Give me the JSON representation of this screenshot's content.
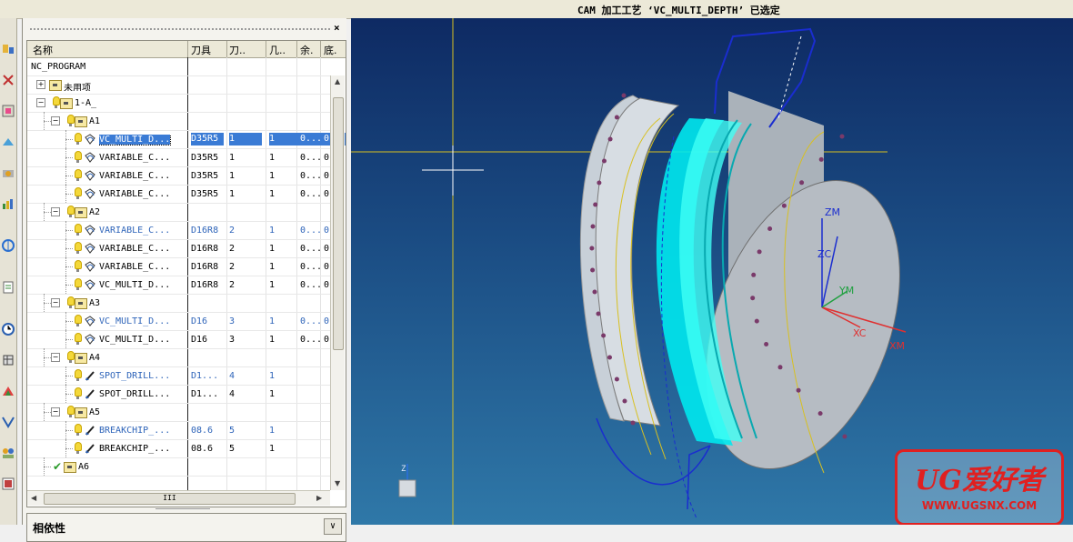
{
  "status_bar": {
    "text": "CAM 加工工艺 ‘VC_MULTI_DEPTH’ 已选定"
  },
  "navigator": {
    "close_label": "×",
    "columns": [
      "名称",
      "刀具",
      "刀..",
      "几..",
      "余.",
      "底."
    ],
    "rows": [
      {
        "name": "NC_PROGRAM",
        "tool": "",
        "c3": "",
        "c4": "",
        "c5": "",
        "c6": "",
        "level": 0,
        "type": "root"
      },
      {
        "name": "未用项",
        "tool": "",
        "c3": "",
        "c4": "",
        "c5": "",
        "c6": "",
        "level": 1,
        "type": "group",
        "expander": "+"
      },
      {
        "name": "1-A_",
        "tool": "",
        "c3": "",
        "c4": "",
        "c5": "",
        "c6": "",
        "level": 1,
        "type": "program",
        "expander": "−"
      },
      {
        "name": "A1",
        "tool": "",
        "c3": "",
        "c4": "",
        "c5": "",
        "c6": "",
        "level": 2,
        "type": "program",
        "expander": "−"
      },
      {
        "name": "VC_MULTI_D...",
        "tool": "D35R5",
        "c3": "1",
        "c4": "1",
        "c5": "0...",
        "c6": "0",
        "level": 3,
        "type": "op",
        "selected": true
      },
      {
        "name": "VARIABLE_C...",
        "tool": "D35R5",
        "c3": "1",
        "c4": "1",
        "c5": "0...",
        "c6": "0",
        "level": 3,
        "type": "op"
      },
      {
        "name": "VARIABLE_C...",
        "tool": "D35R5",
        "c3": "1",
        "c4": "1",
        "c5": "0...",
        "c6": "0",
        "level": 3,
        "type": "op"
      },
      {
        "name": "VARIABLE_C...",
        "tool": "D35R5",
        "c3": "1",
        "c4": "1",
        "c5": "0...",
        "c6": "0",
        "level": 3,
        "type": "op"
      },
      {
        "name": "A2",
        "tool": "",
        "c3": "",
        "c4": "",
        "c5": "",
        "c6": "",
        "level": 2,
        "type": "program",
        "expander": "−"
      },
      {
        "name": "VARIABLE_C...",
        "tool": "D16R8",
        "c3": "2",
        "c4": "1",
        "c5": "0...",
        "c6": "0",
        "level": 3,
        "type": "op",
        "blue": true
      },
      {
        "name": "VARIABLE_C...",
        "tool": "D16R8",
        "c3": "2",
        "c4": "1",
        "c5": "0...",
        "c6": "0",
        "level": 3,
        "type": "op"
      },
      {
        "name": "VARIABLE_C...",
        "tool": "D16R8",
        "c3": "2",
        "c4": "1",
        "c5": "0...",
        "c6": "0",
        "level": 3,
        "type": "op"
      },
      {
        "name": "VC_MULTI_D...",
        "tool": "D16R8",
        "c3": "2",
        "c4": "1",
        "c5": "0...",
        "c6": "0",
        "level": 3,
        "type": "op"
      },
      {
        "name": "A3",
        "tool": "",
        "c3": "",
        "c4": "",
        "c5": "",
        "c6": "",
        "level": 2,
        "type": "program",
        "expander": "−"
      },
      {
        "name": "VC_MULTI_D...",
        "tool": "D16",
        "c3": "3",
        "c4": "1",
        "c5": "0...",
        "c6": "0",
        "level": 3,
        "type": "op",
        "blue": true
      },
      {
        "name": "VC_MULTI_D...",
        "tool": "D16",
        "c3": "3",
        "c4": "1",
        "c5": "0...",
        "c6": "0",
        "level": 3,
        "type": "op"
      },
      {
        "name": "A4",
        "tool": "",
        "c3": "",
        "c4": "",
        "c5": "",
        "c6": "",
        "level": 2,
        "type": "program",
        "expander": "−"
      },
      {
        "name": "SPOT_DRILL...",
        "tool": "D1...",
        "c3": "4",
        "c4": "1",
        "c5": "",
        "c6": "",
        "level": 3,
        "type": "drill",
        "blue": true
      },
      {
        "name": "SPOT_DRILL...",
        "tool": "D1...",
        "c3": "4",
        "c4": "1",
        "c5": "",
        "c6": "",
        "level": 3,
        "type": "drill"
      },
      {
        "name": "A5",
        "tool": "",
        "c3": "",
        "c4": "",
        "c5": "",
        "c6": "",
        "level": 2,
        "type": "program",
        "expander": "−"
      },
      {
        "name": "BREAKCHIP_...",
        "tool": "08.6",
        "c3": "5",
        "c4": "1",
        "c5": "",
        "c6": "",
        "level": 3,
        "type": "drill",
        "blue": true
      },
      {
        "name": "BREAKCHIP_...",
        "tool": "08.6",
        "c3": "5",
        "c4": "1",
        "c5": "",
        "c6": "",
        "level": 3,
        "type": "drill"
      },
      {
        "name": "A6",
        "tool": "",
        "c3": "",
        "c4": "",
        "c5": "",
        "c6": "",
        "level": 2,
        "type": "program-done"
      }
    ],
    "hscroll_thumb_label": "III"
  },
  "dependencies_panel": {
    "title": "相依性",
    "toggle": "∨"
  },
  "viewport": {
    "axis_labels": {
      "zm": "ZM",
      "zc": "ZC",
      "ym": "YM",
      "xc": "XC",
      "xm": "XM"
    },
    "triad_label": "Z"
  },
  "watermark": {
    "title": "UG爱好者",
    "url": "WWW.UGSNX.COM"
  },
  "colors": {
    "selection": "#3a7bd5",
    "blue_text": "#2e64b9",
    "viewport_top": "#0e2a63",
    "viewport_bottom": "#2f78a8",
    "toolpath": "#00f0f0"
  }
}
